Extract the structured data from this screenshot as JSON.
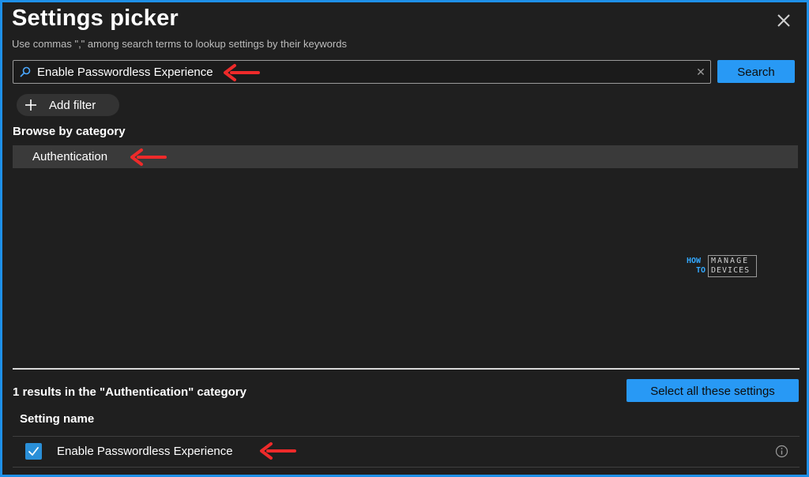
{
  "panel": {
    "title": "Settings picker",
    "subtitle": "Use commas \",\" among search terms to lookup settings by their keywords",
    "close_icon": "close-icon"
  },
  "search": {
    "value": "Enable Passwordless Experience",
    "button_label": "Search",
    "clear_icon": "clear-icon",
    "search_icon": "search-icon"
  },
  "filter": {
    "add_label": "Add filter",
    "icon": "plus-icon"
  },
  "browse": {
    "label": "Browse by category",
    "categories": [
      {
        "label": "Authentication",
        "selected": true
      }
    ]
  },
  "watermark": {
    "line1_left": "HOW",
    "line2_left": "TO",
    "line1_right": "MANAGE",
    "line2_right": "DEVICES"
  },
  "results": {
    "summary": "1 results in the \"Authentication\" category",
    "select_all_label": "Select all these settings",
    "column_header": "Setting name",
    "items": [
      {
        "name": "Enable Passwordless Experience",
        "checked": true,
        "info_icon": "info-icon"
      }
    ]
  },
  "annotations": {
    "arrow_icon": "red-arrow-icon",
    "arrow_color": "#ee2a2a"
  },
  "colors": {
    "accent": "#2899f5",
    "border_frame": "#1e90e8",
    "background": "#1f1f1f",
    "selected_row": "#3a3a3a"
  }
}
